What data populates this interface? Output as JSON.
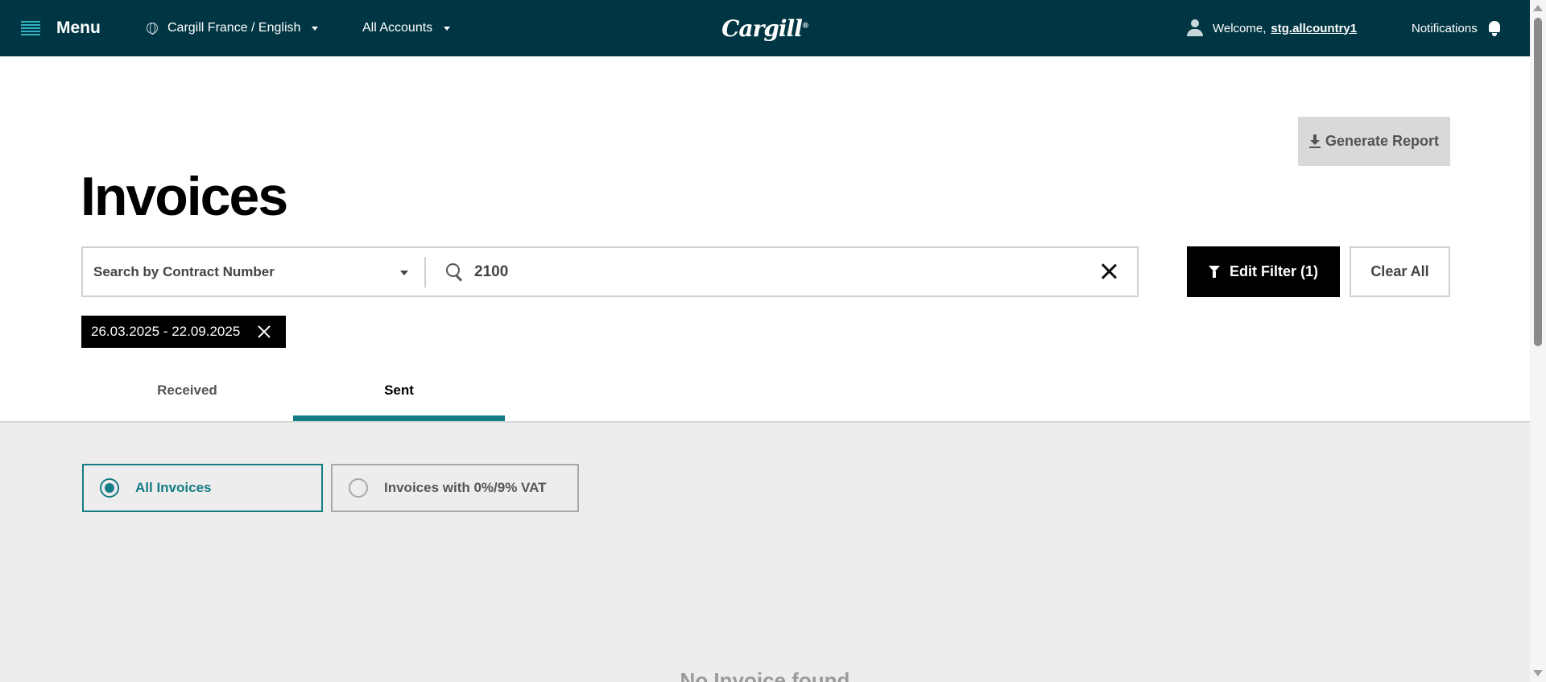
{
  "header": {
    "menu_label": "Menu",
    "locale_label": "Cargill France / English",
    "accounts_label": "All Accounts",
    "logo_text": "Cargill",
    "welcome_prefix": "Welcome,",
    "username": "stg.allcountry1",
    "notifications_label": "Notifications"
  },
  "toolbar": {
    "generate_report_label": "Generate Report"
  },
  "page": {
    "title": "Invoices"
  },
  "search": {
    "select_value": "Search by Contract Number",
    "input_value": "2100"
  },
  "filters": {
    "edit_filter_label": "Edit Filter (1)",
    "clear_all_label": "Clear All",
    "date_chip": "26.03.2025 - 22.09.2025"
  },
  "tabs": [
    {
      "label": "Received",
      "active": false
    },
    {
      "label": "Sent",
      "active": true
    }
  ],
  "invoice_types": [
    {
      "label": "All Invoices",
      "selected": true
    },
    {
      "label": "Invoices with 0%/9% VAT",
      "selected": false
    }
  ],
  "empty_message": "No Invoice found",
  "colors": {
    "header_bg": "#003643",
    "accent": "#147c86",
    "content_bg": "#ededed"
  }
}
